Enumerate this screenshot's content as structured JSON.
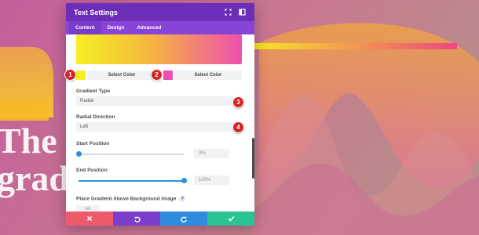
{
  "background": {
    "hero_line_1": "The w",
    "hero_line_2": "gradi"
  },
  "modal": {
    "title": "Text Settings",
    "icons": {
      "expand": "expand-icon",
      "sidebar": "sidebar-toggle-icon"
    },
    "tabs": [
      {
        "label": "Content",
        "active": true
      },
      {
        "label": "Design",
        "active": false
      },
      {
        "label": "Advanced",
        "active": false
      }
    ],
    "gradient": {
      "start_color": "#f7ef22",
      "end_color": "#ee4fae",
      "select_color_1": "Select Color",
      "select_color_2": "Select Color"
    },
    "gradient_type": {
      "label": "Gradient Type",
      "value": "Radial"
    },
    "radial_direction": {
      "label": "Radial Direction",
      "value": "Left"
    },
    "start_position": {
      "label": "Start Position",
      "value": "0%",
      "fraction": 0
    },
    "end_position": {
      "label": "End Position",
      "value": "100%",
      "fraction": 1
    },
    "place_above": {
      "label": "Place Gradient Above Background Image",
      "help": "?",
      "value": "NO"
    },
    "footer": {
      "cancel": {
        "icon": "close-icon",
        "color": "#ef5a6b"
      },
      "undo": {
        "icon": "undo-icon",
        "color": "#7c3fcc"
      },
      "redo": {
        "icon": "redo-icon",
        "color": "#2e8cdf"
      },
      "save": {
        "icon": "check-icon",
        "color": "#29c394"
      }
    }
  },
  "markers": [
    "1",
    "2",
    "3",
    "4"
  ]
}
